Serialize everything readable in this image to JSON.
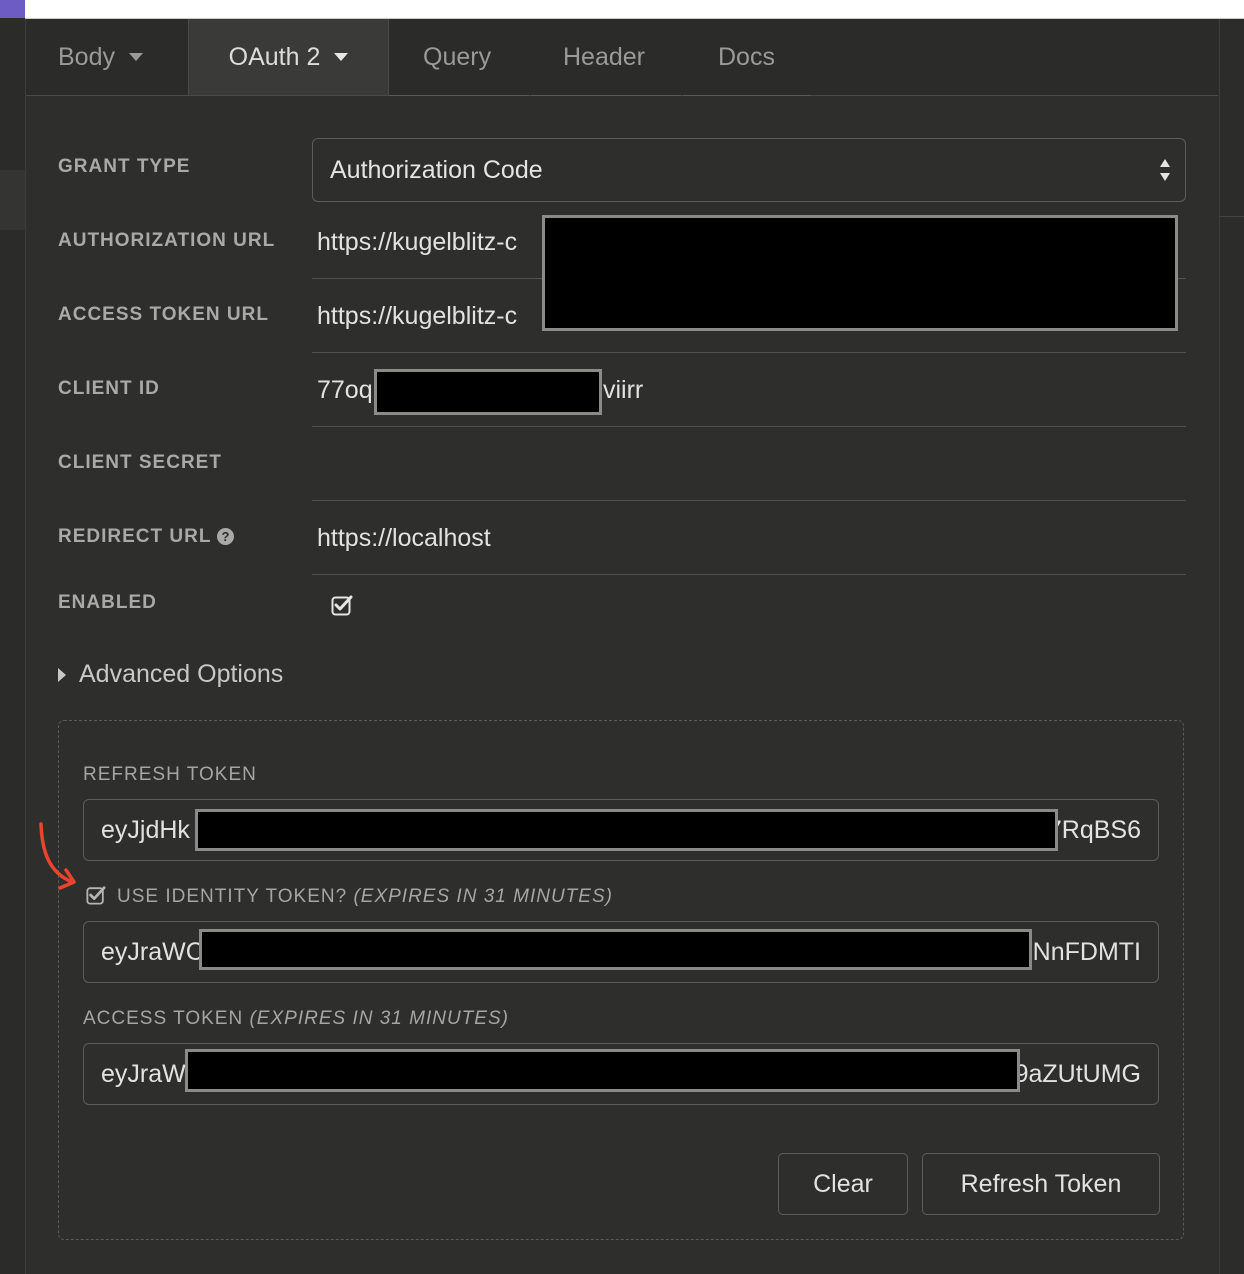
{
  "tabs": [
    {
      "label": "Body",
      "has_caret": true
    },
    {
      "label": "OAuth 2",
      "has_caret": true,
      "active": true
    },
    {
      "label": "Query"
    },
    {
      "label": "Header"
    },
    {
      "label": "Docs"
    }
  ],
  "form": {
    "grant_type": {
      "label": "GRANT TYPE",
      "value": "Authorization Code"
    },
    "authorization_url": {
      "label": "AUTHORIZATION URL",
      "value": "https://kugelblitz-c"
    },
    "access_token_url": {
      "label": "ACCESS TOKEN URL",
      "value": "https://kugelblitz-c"
    },
    "client_id": {
      "label": "CLIENT ID",
      "value_start": "77oq",
      "value_end": "viirr"
    },
    "client_secret": {
      "label": "CLIENT SECRET",
      "value": ""
    },
    "redirect_url": {
      "label": "REDIRECT URL",
      "value": "https://localhost",
      "help_icon": "question-circle-icon"
    },
    "enabled": {
      "label": "ENABLED",
      "checked": true
    }
  },
  "advanced_options": {
    "label": "Advanced Options",
    "expanded": false
  },
  "tokens": {
    "refresh": {
      "label": "REFRESH TOKEN",
      "start": "eyJjdHk",
      "end": "7RqBS6"
    },
    "identity": {
      "label": "USE IDENTITY TOKEN?",
      "expires": "(EXPIRES IN 31 MINUTES)",
      "checked": true,
      "start": "eyJraWC",
      "end": "NnFDMTI"
    },
    "access": {
      "label": "ACCESS TOKEN",
      "expires": "(EXPIRES IN 31 MINUTES)",
      "start": "eyJraW",
      "end": "9aZUtUMG"
    }
  },
  "buttons": {
    "clear": "Clear",
    "refresh": "Refresh Token"
  },
  "colors": {
    "accent": "#6d5cc4",
    "background": "#2e2e2c",
    "annotation": "#e8452c"
  }
}
